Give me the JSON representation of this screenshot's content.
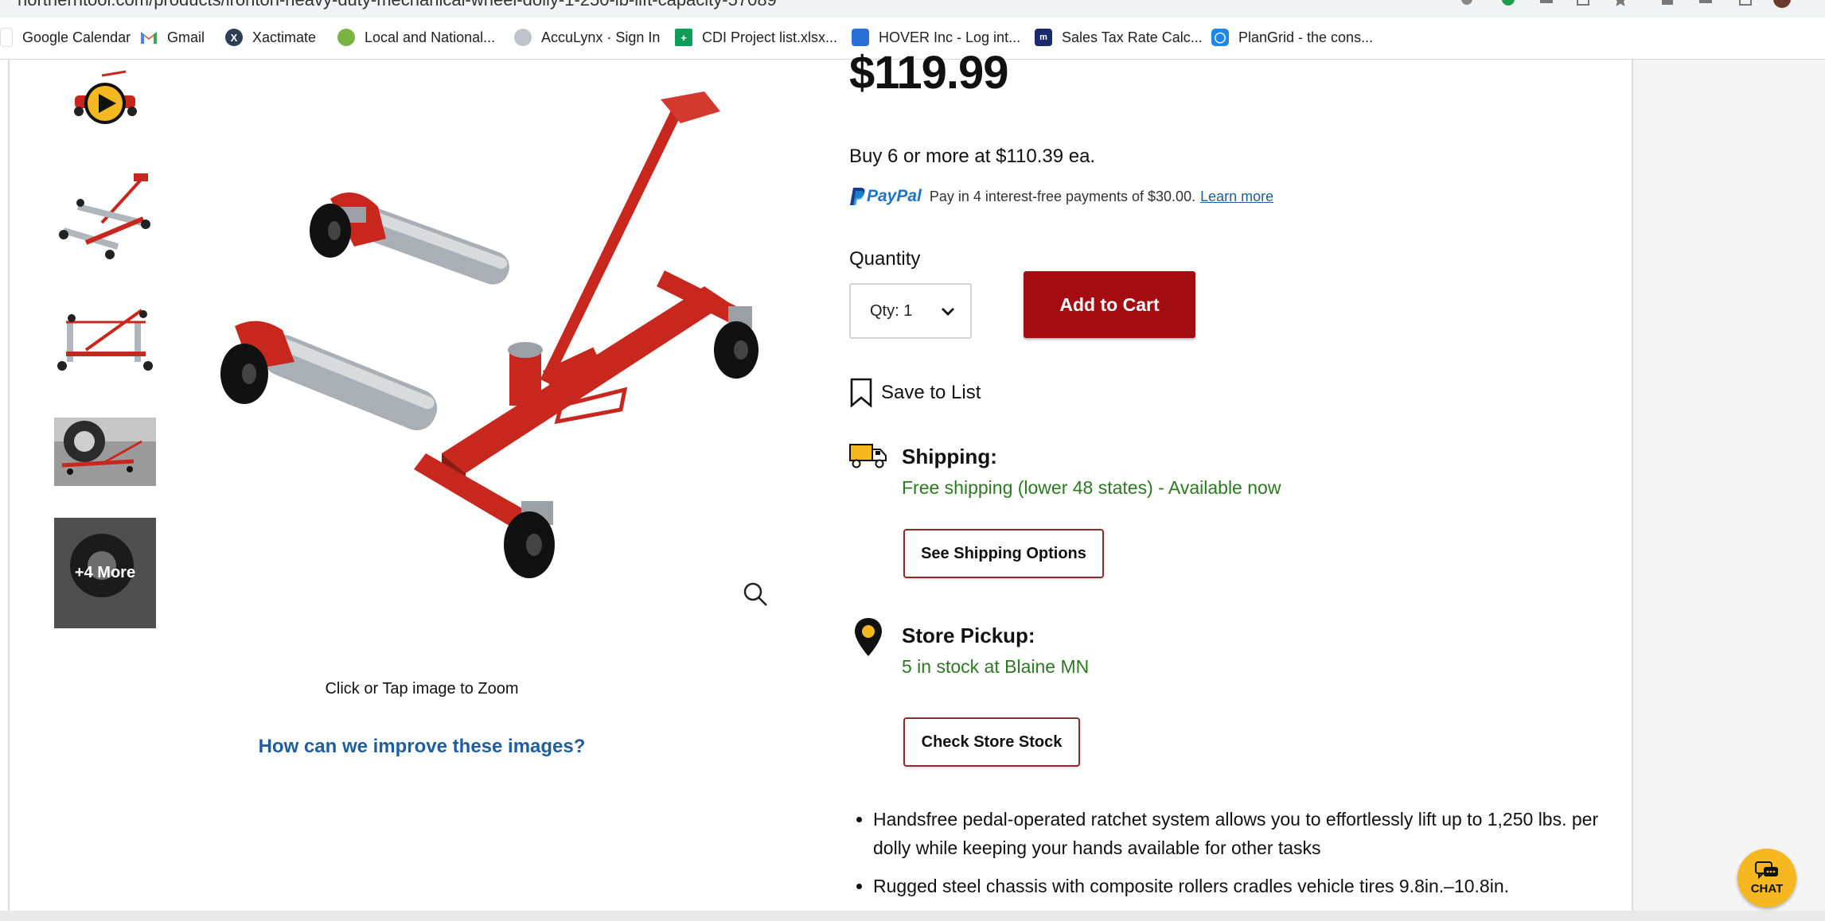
{
  "browser": {
    "url": "northerntool.com/products/ironton-heavy-duty-mechanical-wheel-dolly-1-250-lb-lift-capacity-57089",
    "bookmarks": [
      {
        "label": "Google Calendar",
        "icon": "google-calendar-icon",
        "color": "#4285f4"
      },
      {
        "label": "Gmail",
        "icon": "gmail-icon",
        "color": "#ea4335"
      },
      {
        "label": "Xactimate",
        "icon": "xactimate-icon",
        "color": "#2f3e56"
      },
      {
        "label": "Local and National...",
        "icon": "local-national-icon",
        "color": "#7bb342"
      },
      {
        "label": "AccuLynx · Sign In",
        "icon": "acculynx-icon",
        "color": "#9aa0a6"
      },
      {
        "label": "CDI Project list.xlsx...",
        "icon": "sheets-icon",
        "color": "#0f9d58"
      },
      {
        "label": "HOVER Inc - Log int...",
        "icon": "hover-icon",
        "color": "#2a6fd6"
      },
      {
        "label": "Sales Tax Rate Calc...",
        "icon": "sales-tax-icon",
        "color": "#1b2a6b"
      },
      {
        "label": "PlanGrid - the cons...",
        "icon": "plangrid-icon",
        "color": "#1e88e5"
      }
    ]
  },
  "gallery": {
    "more_label": "+4 More",
    "zoom_caption": "Click or Tap image to Zoom",
    "improve_link": "How can we improve these images?"
  },
  "product": {
    "price": "$119.99",
    "bulk_offer": "Buy 6 or more at $110.39 ea.",
    "paypal": {
      "brand": "PayPal",
      "text": "Pay in 4 interest-free payments of $30.00.",
      "learn_more": "Learn more"
    },
    "quantity_label": "Quantity",
    "quantity_value": "Qty: 1",
    "add_to_cart": "Add to Cart",
    "save_to_list": "Save to List"
  },
  "shipping": {
    "heading": "Shipping:",
    "status": "Free shipping (lower 48 states) - Available now",
    "button": "See Shipping Options"
  },
  "pickup": {
    "heading": "Store Pickup:",
    "status": "5 in stock at Blaine MN",
    "button": "Check Store Stock"
  },
  "features": [
    "Handsfree pedal-operated ratchet system allows you to effortlessly lift up to 1,250 lbs. per dolly while keeping your hands available for other tasks",
    "Rugged steel chassis with composite rollers cradles vehicle tires 9.8in.–10.8in."
  ],
  "chat": {
    "label": "CHAT"
  },
  "colors": {
    "cart_red": "#a30d12",
    "in_stock_green": "#2b7a1f",
    "link_blue": "#1f5fa0",
    "chat_yellow": "#f5b820"
  }
}
